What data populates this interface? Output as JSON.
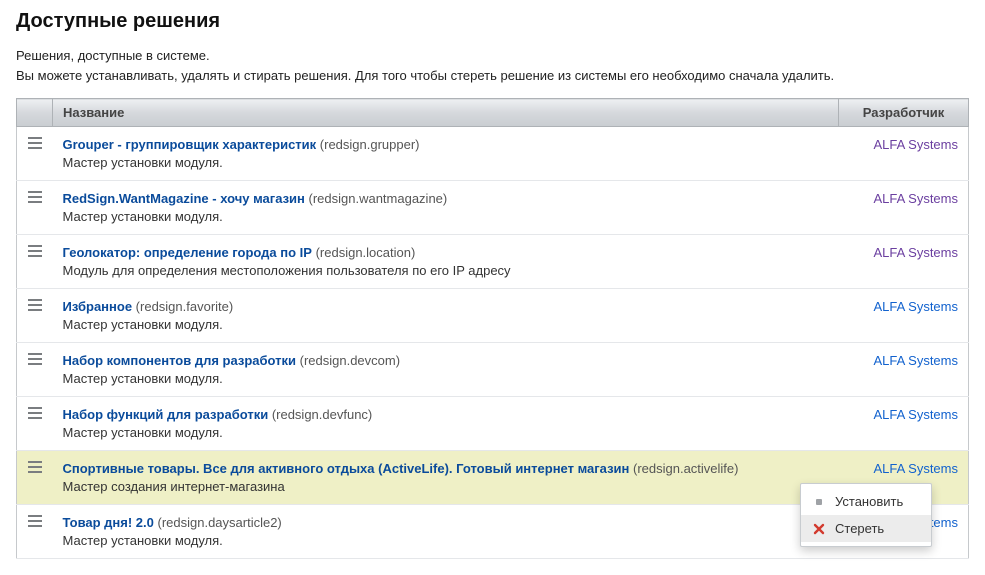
{
  "title": "Доступные решения",
  "introLines": [
    "Решения, доступные в системе.",
    "Вы можете устанавливать, удалять и стирать решения. Для того чтобы стереть решение из системы его необходимо сначала удалить."
  ],
  "columns": {
    "name": "Название",
    "developer": "Разработчик"
  },
  "developer": "ALFA Systems",
  "rows": [
    {
      "name": "Grouper - группировщик характеристик",
      "code": "(redsign.grupper)",
      "desc": "Мастер установки модуля.",
      "devVisited": true
    },
    {
      "name": "RedSign.WantMagazine - хочу магазин",
      "code": "(redsign.wantmagazine)",
      "desc": "Мастер установки модуля.",
      "devVisited": true
    },
    {
      "name": "Геолокатор: определение города по IP",
      "code": "(redsign.location)",
      "desc": "Модуль для определения местоположения пользователя по его IP адресу",
      "devVisited": true
    },
    {
      "name": "Избранное",
      "code": "(redsign.favorite)",
      "desc": "Мастер установки модуля.",
      "devVisited": false
    },
    {
      "name": "Набор компонентов для разработки",
      "code": "(redsign.devcom)",
      "desc": "Мастер установки модуля.",
      "devVisited": false
    },
    {
      "name": "Набор функций для разработки",
      "code": "(redsign.devfunc)",
      "desc": "Мастер установки модуля.",
      "devVisited": false
    },
    {
      "name": "Спортивные товары. Все для активного отдыха (ActiveLife). Готовый интернет магазин",
      "code": "(redsign.activelife)",
      "desc": "Мастер создания интернет-магазина",
      "devVisited": false,
      "highlight": true
    },
    {
      "name": "Товар дня! 2.0",
      "code": "(redsign.daysarticle2)",
      "desc": "Мастер установки модуля.",
      "devVisited": false
    }
  ],
  "menu": {
    "install": "Установить",
    "erase": "Стереть"
  }
}
